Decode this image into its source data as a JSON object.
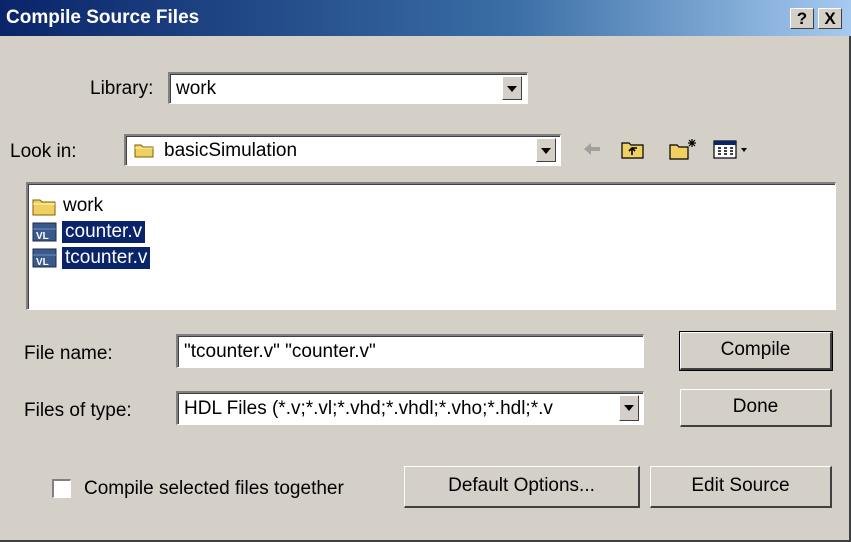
{
  "window": {
    "title": "Compile Source Files",
    "help_button": "?",
    "close_button": "X"
  },
  "library": {
    "label": "Library:",
    "value": "work"
  },
  "lookin": {
    "label": "Look in:",
    "value": "basicSimulation"
  },
  "toolbar": {
    "icons": [
      "back-arrow-icon",
      "up-folder-icon",
      "new-folder-icon",
      "view-menu-icon"
    ]
  },
  "file_list": {
    "items": [
      {
        "name": "work",
        "type": "folder",
        "selected": false
      },
      {
        "name": "counter.v",
        "type": "verilog",
        "selected": true
      },
      {
        "name": "tcounter.v",
        "type": "verilog",
        "selected": true
      }
    ],
    "verilog_icon_text": "VL"
  },
  "filename": {
    "label": "File name:",
    "value": "\"tcounter.v\" \"counter.v\""
  },
  "filetype": {
    "label": "Files of type:",
    "value": "HDL Files (*.v;*.vl;*.vhd;*.vhdl;*.vho;*.hdl;*.v"
  },
  "buttons": {
    "compile": "Compile",
    "done": "Done",
    "default_options": "Default Options...",
    "edit_source": "Edit Source"
  },
  "options": {
    "compile_together_label": "Compile selected files together",
    "compile_together_checked": false
  },
  "colors": {
    "selection": "#0a246a",
    "title_start": "#0a246a",
    "title_end": "#a6caf0",
    "face": "#d4d0c8"
  }
}
